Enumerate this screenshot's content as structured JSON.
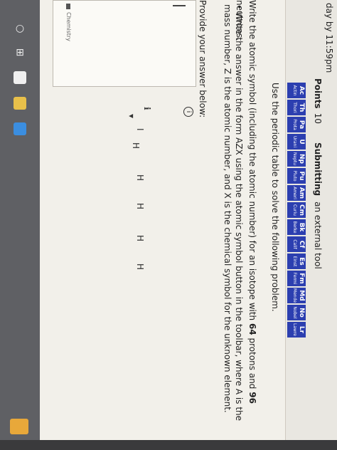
{
  "header": {
    "due": "day by 11:59pm",
    "points_label": "Points",
    "points_value": "10",
    "submitting_label": "Submitting",
    "submitting_value": "an external tool"
  },
  "periodic_elements": [
    {
      "sym": "Ac",
      "name": "Actinium"
    },
    {
      "sym": "Th",
      "name": "Thorium"
    },
    {
      "sym": "Pa",
      "name": "Protactinium"
    },
    {
      "sym": "U",
      "name": "Uranium"
    },
    {
      "sym": "Np",
      "name": "Neptunium"
    },
    {
      "sym": "Pu",
      "name": "Plutonium"
    },
    {
      "sym": "Am",
      "name": "Americium"
    },
    {
      "sym": "Cm",
      "name": "Curium"
    },
    {
      "sym": "Bk",
      "name": "Berkelium"
    },
    {
      "sym": "Cf",
      "name": "Californium"
    },
    {
      "sym": "Es",
      "name": "Einsteinium"
    },
    {
      "sym": "Fm",
      "name": "Fermium"
    },
    {
      "sym": "Md",
      "name": "Mendelevium"
    },
    {
      "sym": "No",
      "name": "Nobelium"
    },
    {
      "sym": "Lr",
      "name": "Lawrencium"
    }
  ],
  "problem": {
    "instruction": "Use the periodic table to solve the following problem.",
    "question_pre": "Write the atomic symbol (including the atomic number) for an isotope with ",
    "protons": "64",
    "question_mid": " protons and ",
    "neutrons": "96",
    "question_post": " neutrons.",
    "bullet": "Write the answer in the form AZX using the atomic symbol button in the toolbar, where A is the mass number, Z is the atomic number, and X is the chemical symbol for the unknown element.",
    "provide": "Provide your answer below:"
  },
  "answer": {
    "chem_label": "Chemistry",
    "tools": [
      "I",
      "▾",
      "ℹ",
      "H",
      "H",
      "H",
      "H",
      "H"
    ]
  },
  "taskbar": {
    "icons": [
      "search-icon",
      "task-view-icon",
      "app-icon-1",
      "app-icon-2",
      "app-icon-3"
    ]
  }
}
